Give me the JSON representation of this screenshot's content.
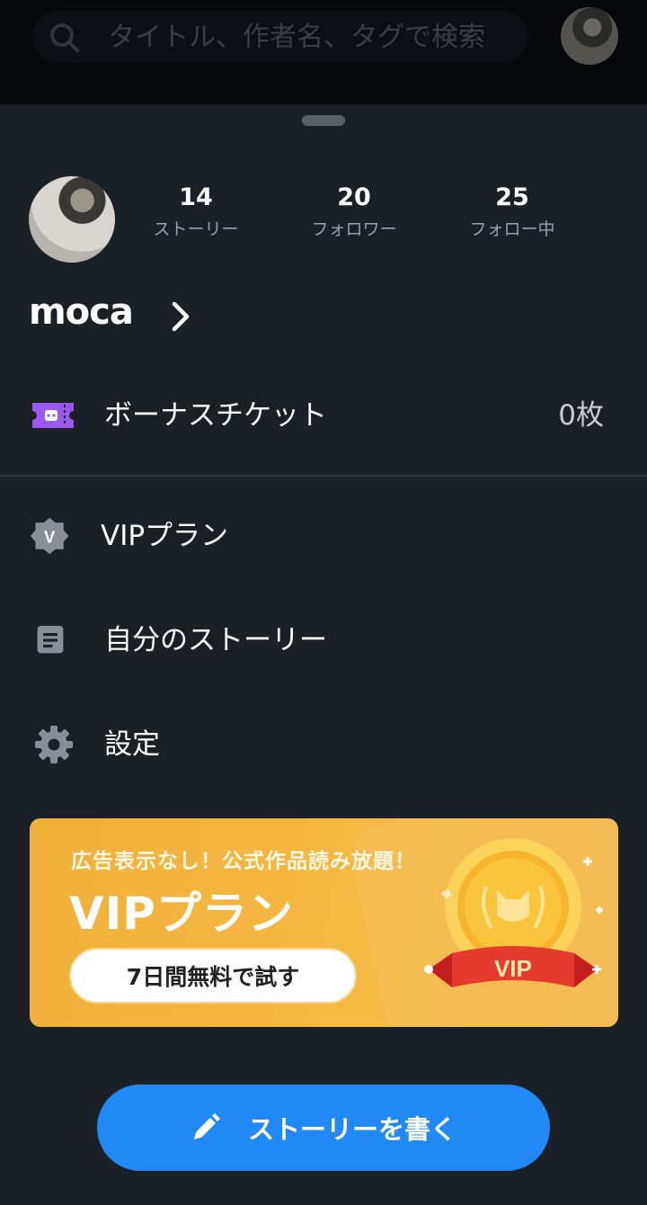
{
  "search": {
    "placeholder": "タイトル、作者名、タグで検索"
  },
  "profile": {
    "username": "moca",
    "stats": [
      {
        "value": "14",
        "label": "ストーリー"
      },
      {
        "value": "20",
        "label": "フォロワー"
      },
      {
        "value": "25",
        "label": "フォロー中"
      }
    ]
  },
  "menu": {
    "ticket": {
      "label": "ボーナスチケット",
      "value": "0枚",
      "icon": "ticket-icon"
    },
    "vip": {
      "label": "VIPプラン",
      "icon": "vip-badge-icon"
    },
    "stories": {
      "label": "自分のストーリー",
      "icon": "document-icon"
    },
    "settings": {
      "label": "設定",
      "icon": "gear-icon"
    }
  },
  "banner": {
    "subtitle": "広告表示なし！公式作品読み放題！",
    "title": "VIPプラン",
    "cta": "7日間無料で試す",
    "medal_label": "VIP"
  },
  "write_button": {
    "label": "ストーリーを書く",
    "icon": "pencil-icon"
  },
  "colors": {
    "accent": "#2089f5",
    "banner": "#f3b33f",
    "ticket": "#9b59f0",
    "background": "#1b1f26"
  }
}
